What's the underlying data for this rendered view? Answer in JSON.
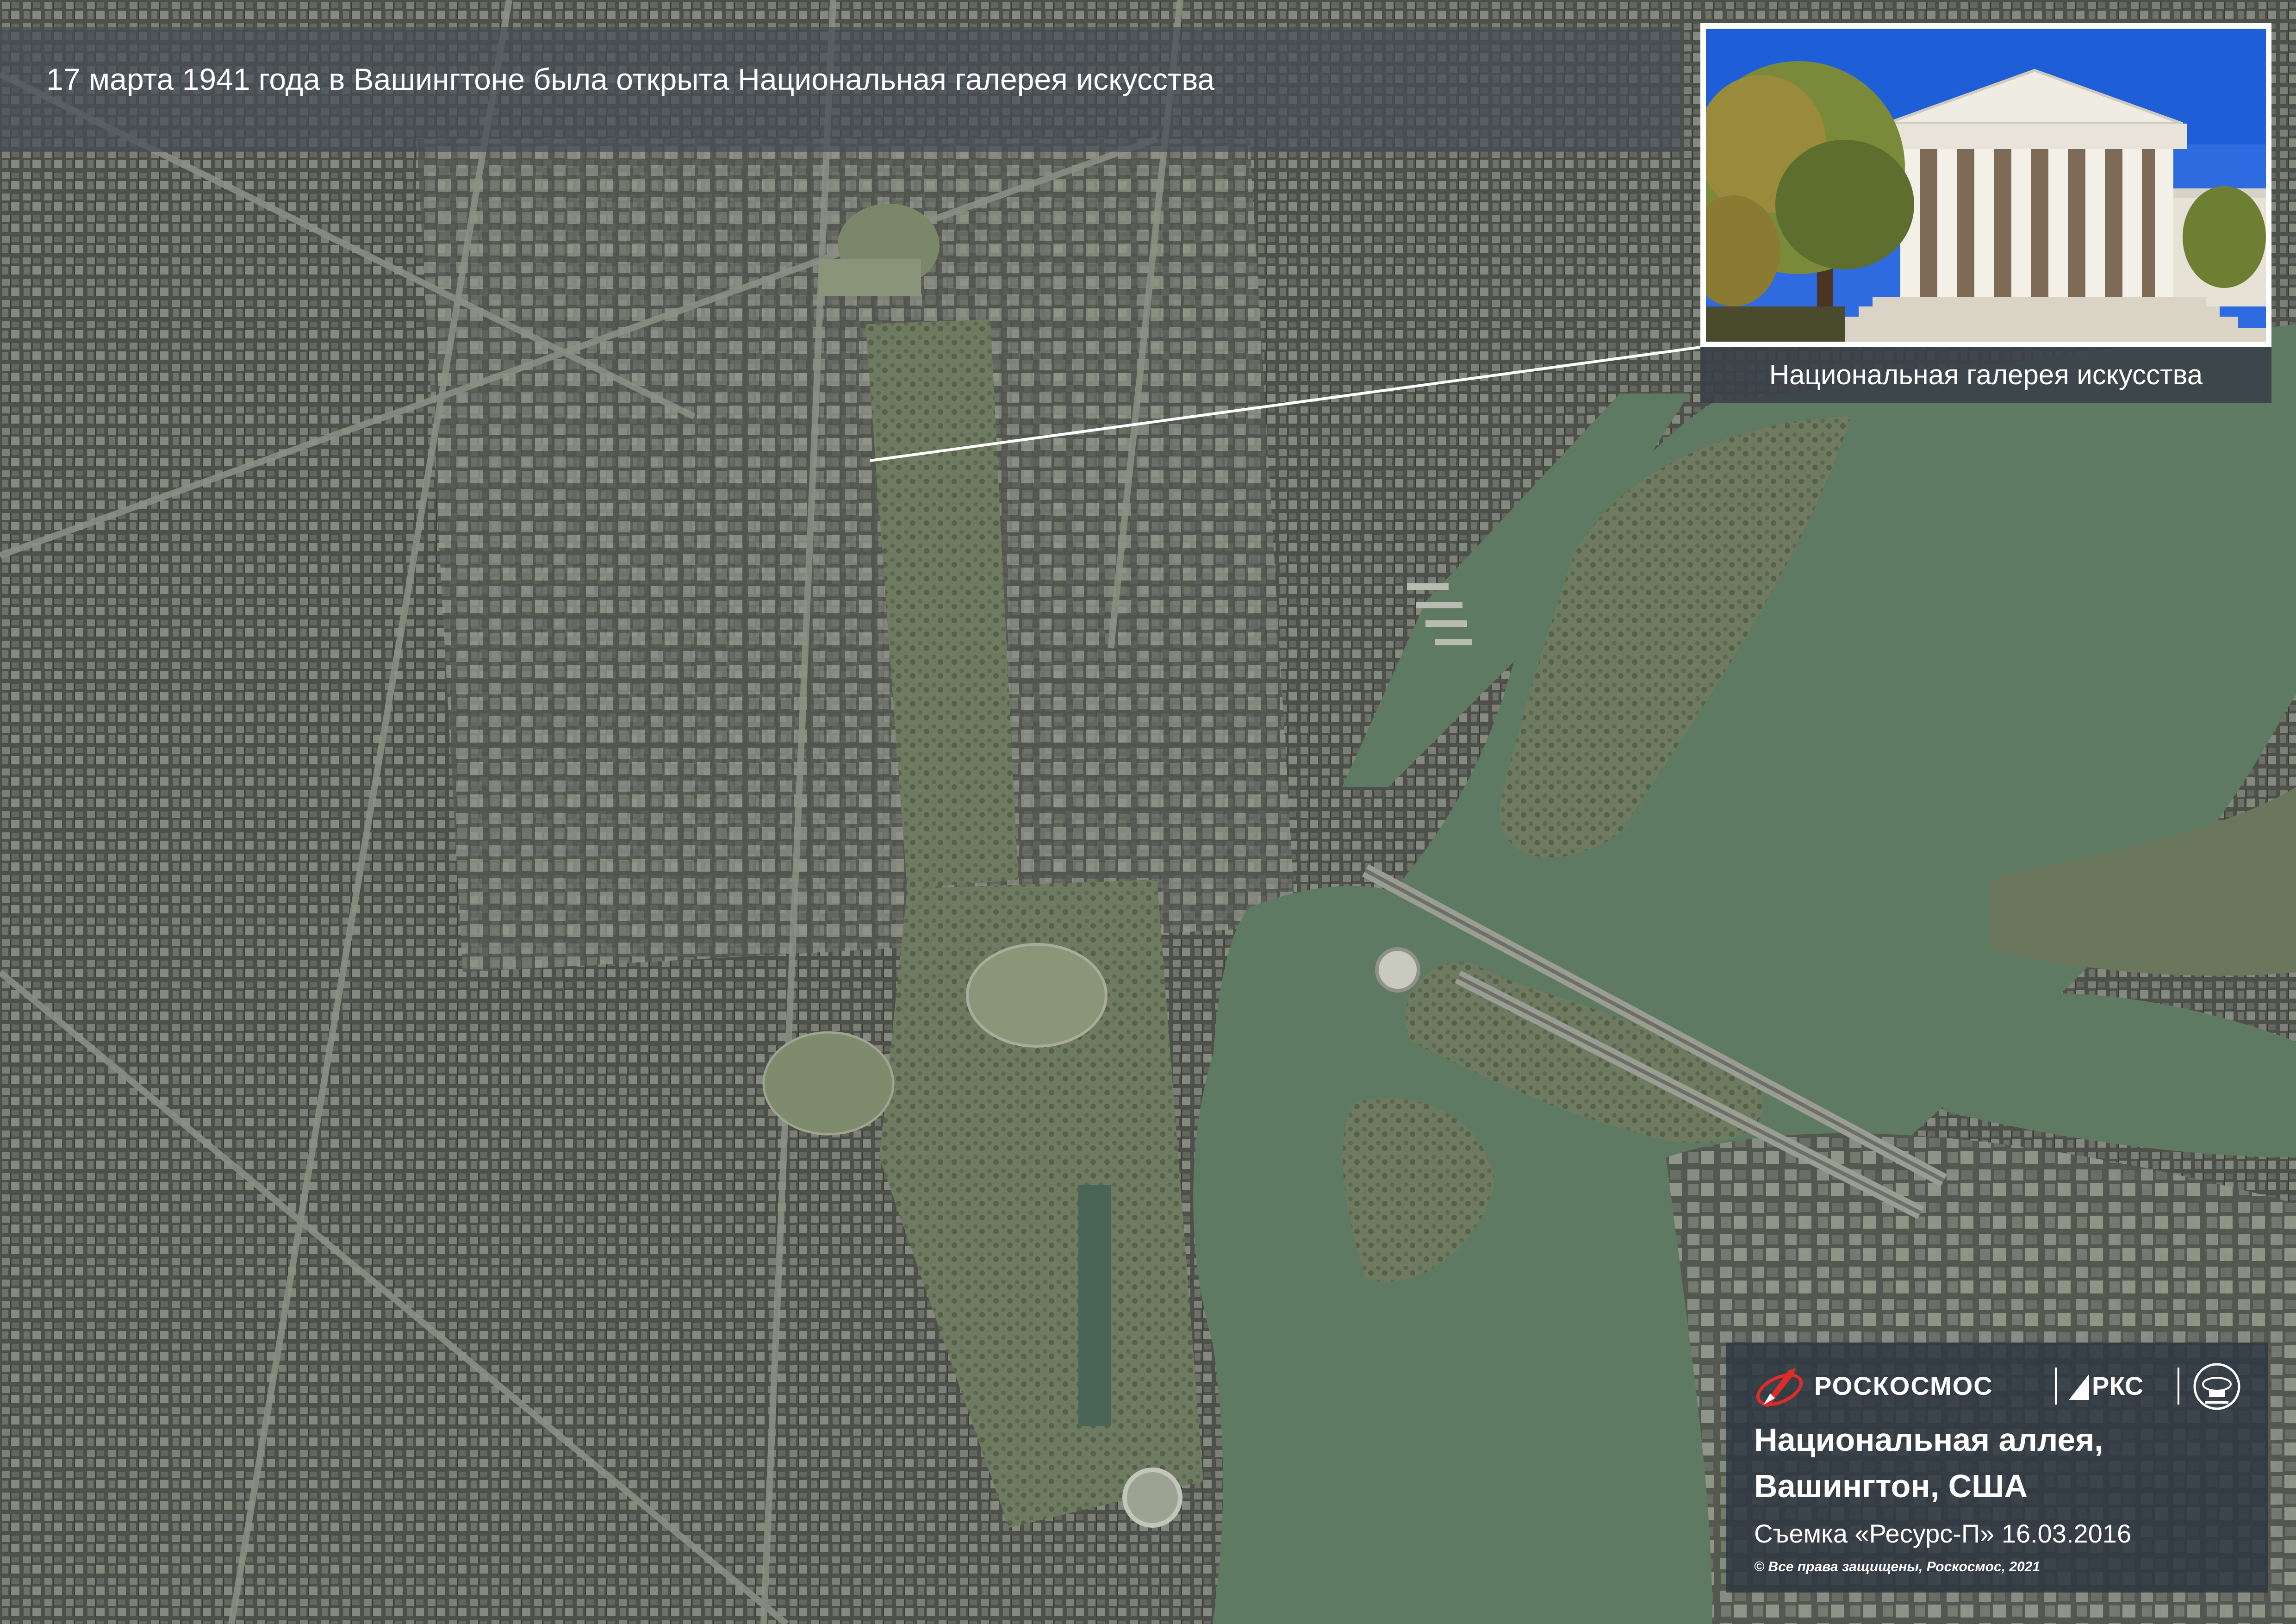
{
  "title": "17 марта 1941 года в Вашингтоне была открыта Национальная галерея искусства",
  "inset": {
    "caption": "Национальная галерея искусства",
    "photo_subject": "National Gallery of Art neoclassical facade with columns"
  },
  "info": {
    "logos": {
      "roscosmos": "РОСКОСМОС",
      "rks": "РКС",
      "rocket_icon": "roscosmos-rocket-icon",
      "emblem_icon": "rks-emblem-icon"
    },
    "place_line1": "Национальная аллея,",
    "place_line2": "Вашингтон, США",
    "shot": "Съемка «Ресурс-П» 16.03.2016",
    "copyright": "© Все права защищены, Роскосмос, 2021"
  },
  "colors": {
    "river": "#5f7a62",
    "city": "#55594f",
    "park": "#7e8a6c",
    "title_bar": "#464e56",
    "info_box": "#2e3842"
  }
}
